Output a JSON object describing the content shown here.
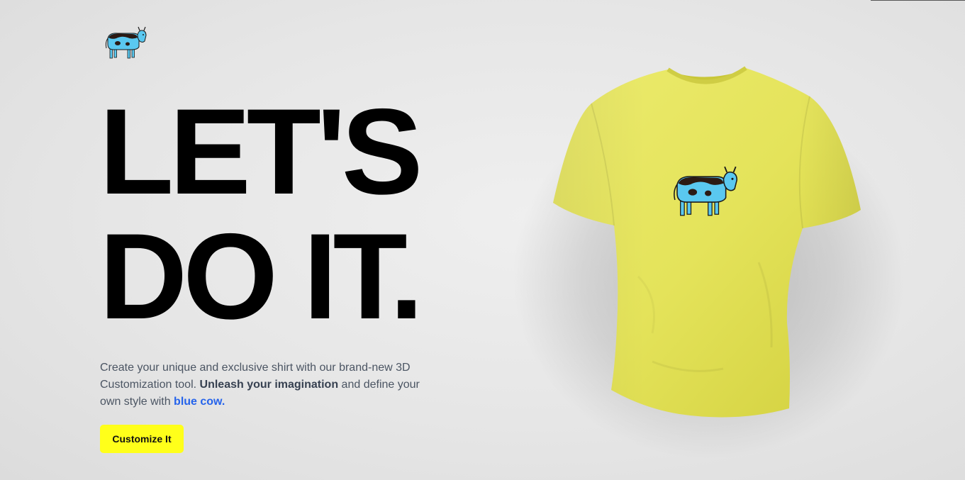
{
  "brand": {
    "logo_icon": "blue-cow-icon",
    "colors": {
      "cow_blue": "#5ac8f0",
      "cow_spots": "#2b1a14",
      "accent_yellow": "#ffff1a",
      "shirt_yellow": "#e6e55a",
      "link_blue": "#2563eb"
    }
  },
  "hero": {
    "headline_line1": "LET'S",
    "headline_line2": "DO IT.",
    "description_part1": "Create your unique and exclusive shirt with our brand-new 3D Customization tool. ",
    "description_bold": "Unleash your imagination",
    "description_part2": " and define your own style with ",
    "description_brand": "blue cow.",
    "cta_label": "Customize It"
  },
  "preview": {
    "shirt_icon": "tshirt-model",
    "shirt_decal_icon": "blue-cow-icon"
  }
}
